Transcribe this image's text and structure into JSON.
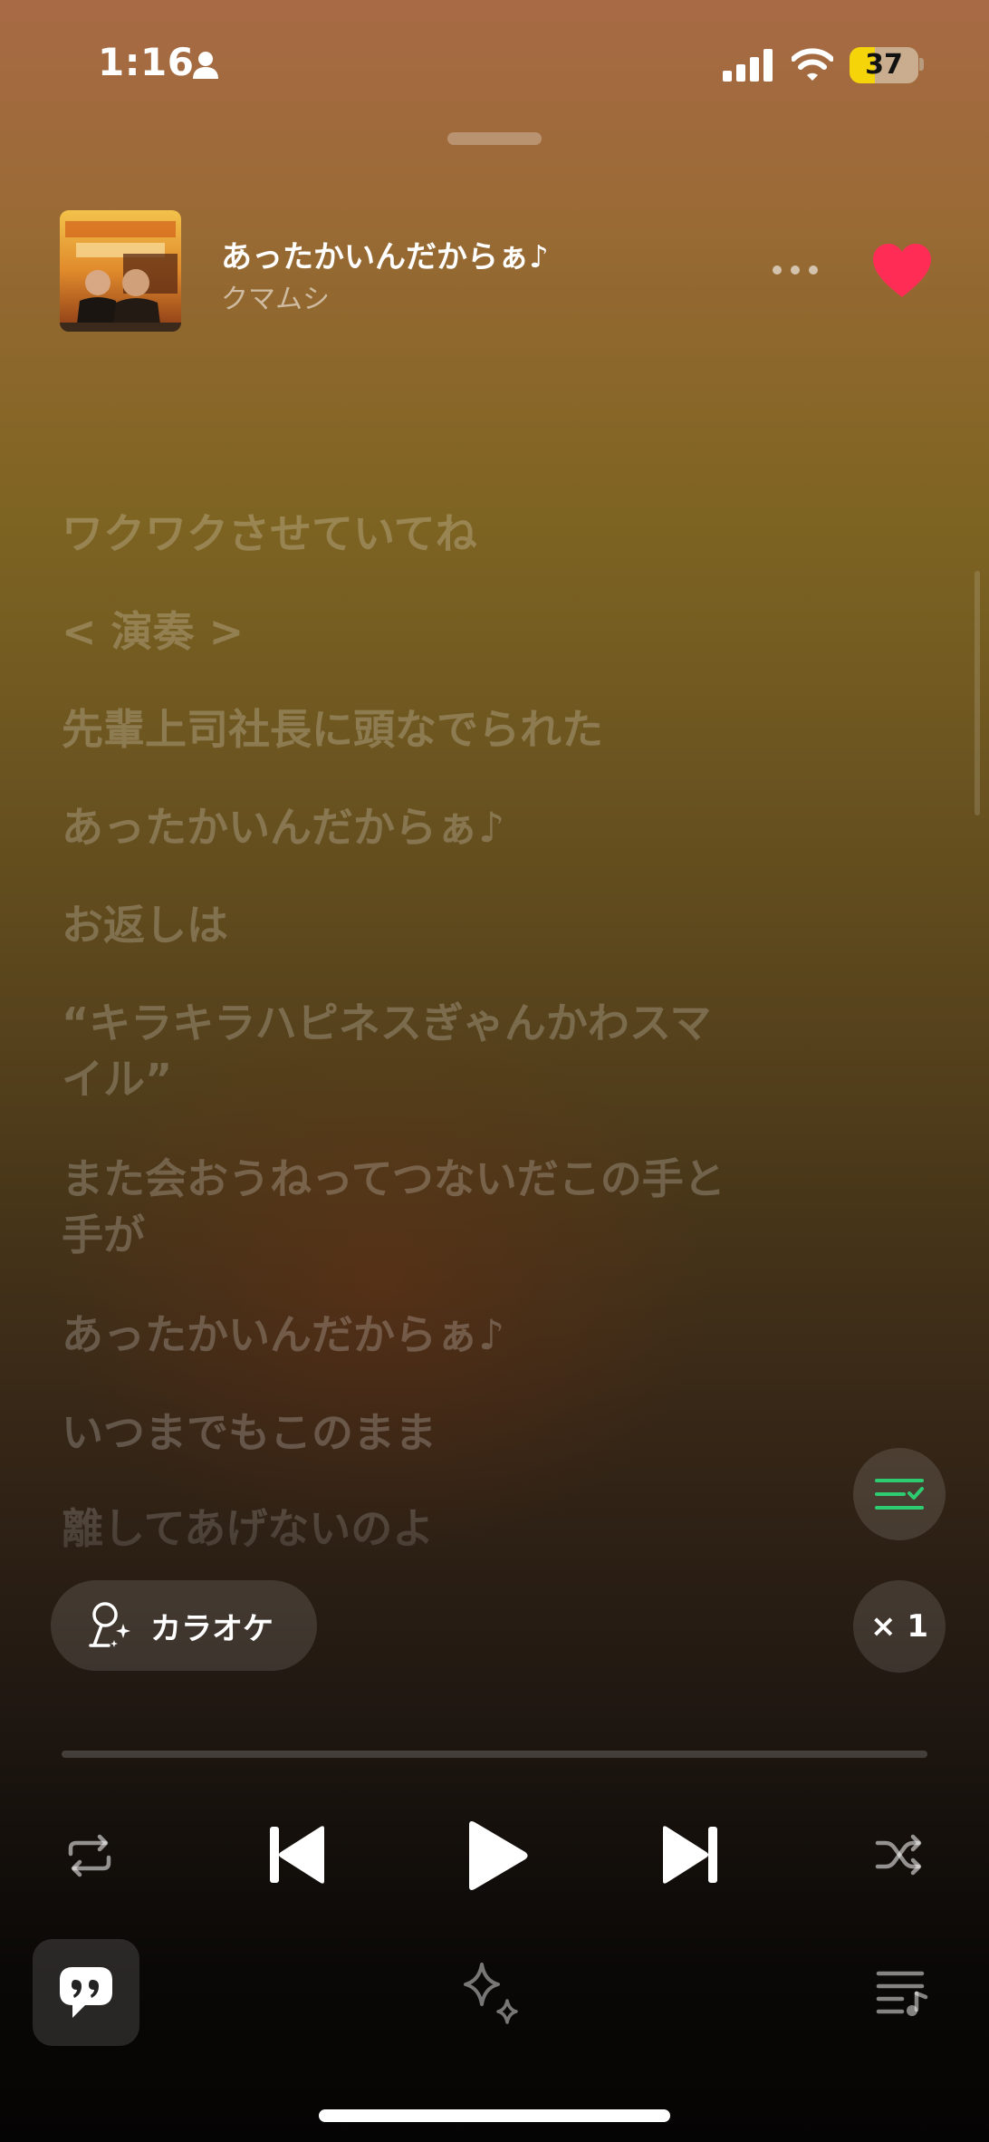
{
  "status_bar": {
    "time": "1:16",
    "battery": "37"
  },
  "now_playing": {
    "title": "あったかいんだからぁ♪",
    "artist": "クマムシ",
    "liked": true
  },
  "album_art": {
    "colors": [
      "#e8a53a",
      "#c9621c",
      "#3b2a1c"
    ]
  },
  "lyrics": [
    "ワクワクさせていてね",
    "< 演奏 >",
    "先輩上司社長に頭なでられた",
    "あったかいんだからぁ♪",
    "お返しは",
    "“キラキラハピネスぎゃんかわスマ\nイル”",
    "また会おうねってつないだこの手と\n手が",
    "あったかいんだからぁ♪",
    "いつまでもこのまま",
    "離してあげないのよ"
  ],
  "controls": {
    "karaoke_label": "カラオケ",
    "speed_label": "× 1",
    "progress": 0
  },
  "colors": {
    "accent_green": "#2ecc71",
    "heart_red": "#ff2d55"
  },
  "icons": [
    "person-icon",
    "signal-icon",
    "wifi-icon",
    "heart-icon",
    "more-icon",
    "queue-check-icon",
    "microphone-sparkle-icon",
    "repeat-icon",
    "previous-icon",
    "play-icon",
    "next-icon",
    "shuffle-icon",
    "quote-icon",
    "sparkle-icon",
    "playlist-icon"
  ]
}
